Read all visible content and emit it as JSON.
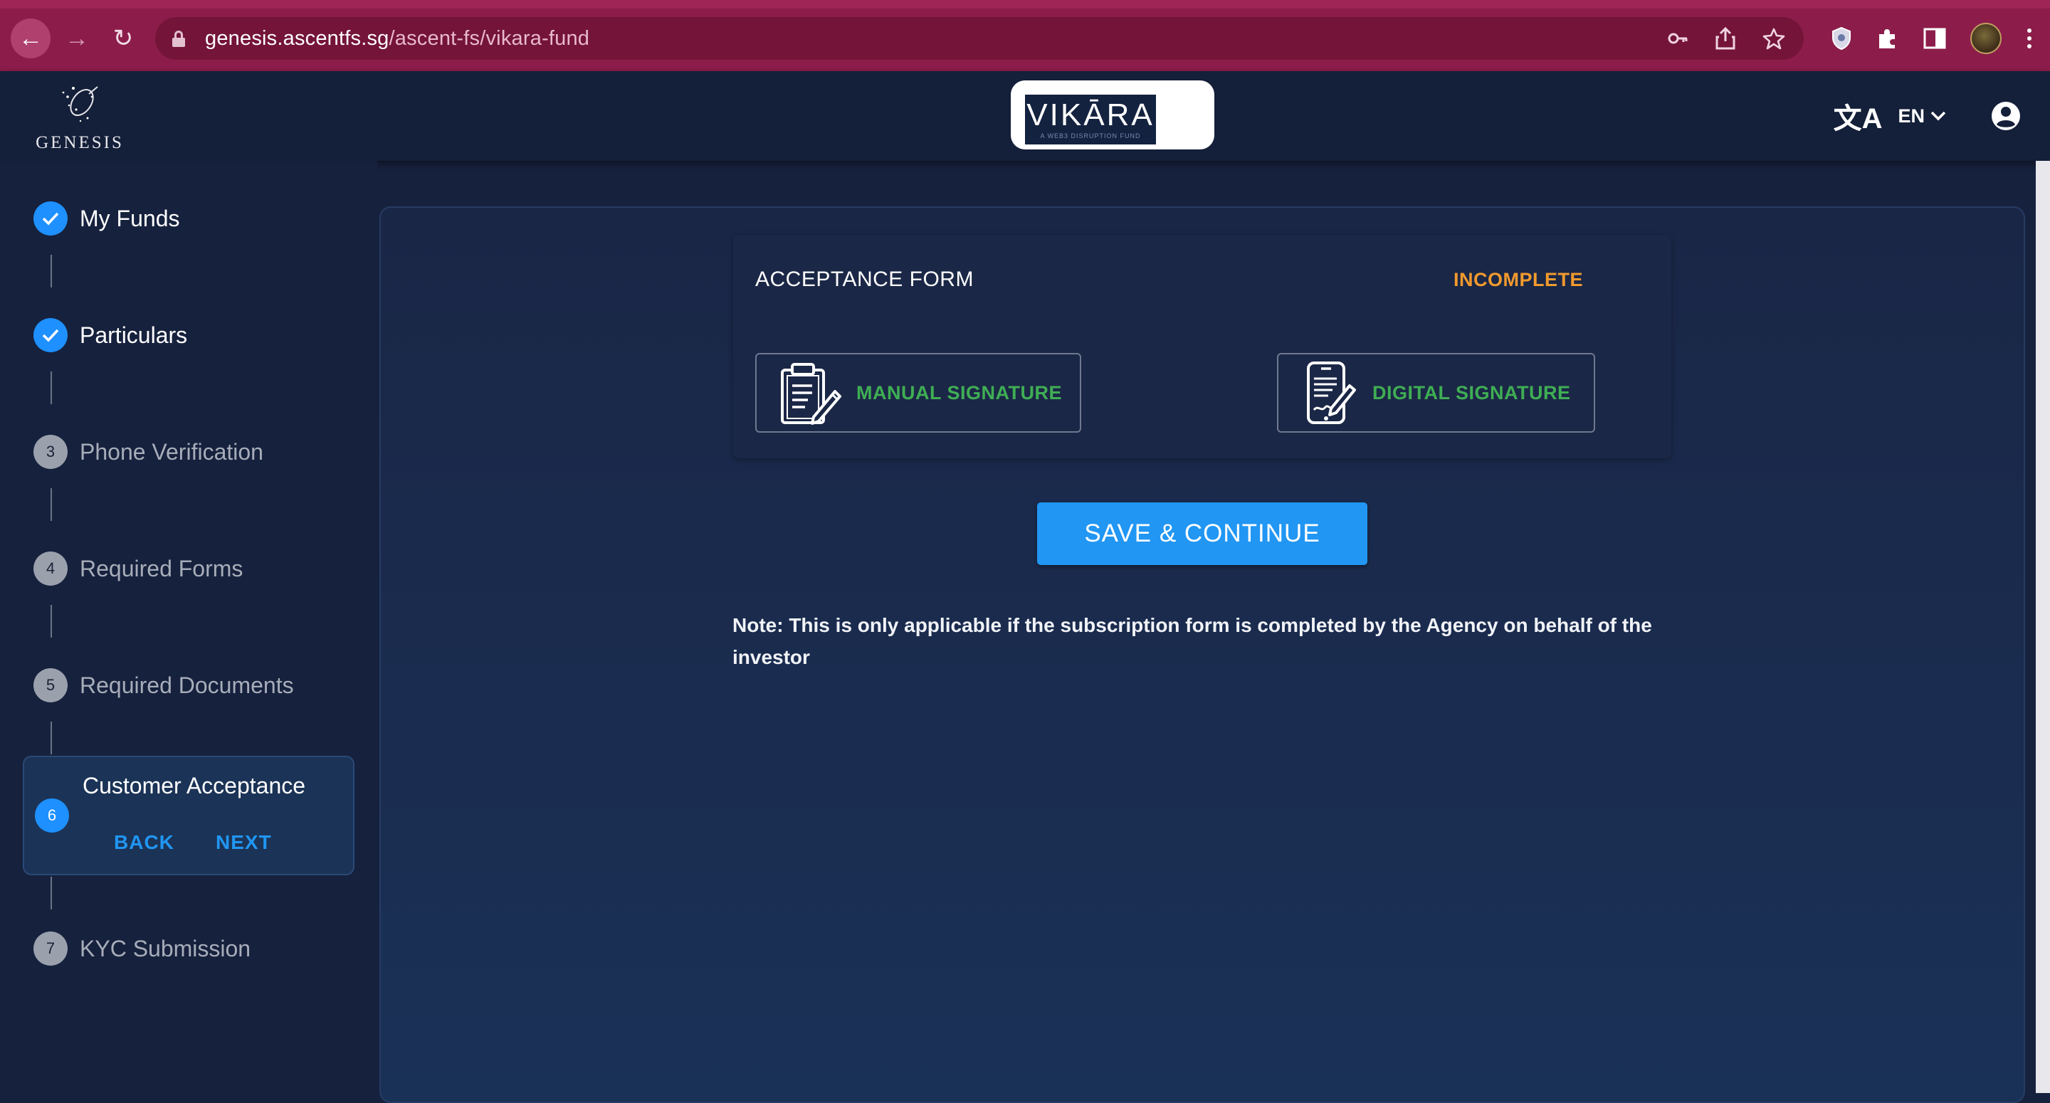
{
  "browser": {
    "url_domain": "genesis.ascentfs.sg",
    "url_path": "/ascent-fs/vikara-fund"
  },
  "header": {
    "brand_name": "GENESIS",
    "fund_logo_text": "VIKĀRA",
    "fund_logo_tagline": "A WEB3 DISRUPTION FUND",
    "language": "EN"
  },
  "stepper": {
    "steps": [
      {
        "number": "1",
        "label": "My Funds",
        "state": "done"
      },
      {
        "number": "2",
        "label": "Particulars",
        "state": "done"
      },
      {
        "number": "3",
        "label": "Phone Verification",
        "state": "todo"
      },
      {
        "number": "4",
        "label": "Required Forms",
        "state": "todo"
      },
      {
        "number": "5",
        "label": "Required Documents",
        "state": "todo"
      },
      {
        "number": "6",
        "label": "Customer Acceptance",
        "state": "active"
      },
      {
        "number": "7",
        "label": "KYC Submission",
        "state": "todo"
      }
    ],
    "back_label": "BACK",
    "next_label": "NEXT"
  },
  "form": {
    "title": "ACCEPTANCE FORM",
    "status": "INCOMPLETE",
    "manual_label": "MANUAL SIGNATURE",
    "digital_label": "DIGITAL SIGNATURE",
    "save_label": "SAVE & CONTINUE",
    "note": "Note: This is only applicable if the subscription form is completed by the Agency on behalf of the investor"
  },
  "colors": {
    "accent": "#2196f3",
    "status_incomplete": "#f29a2e",
    "signature_green": "#3fae54",
    "browser_theme": "#8c1d4a"
  }
}
